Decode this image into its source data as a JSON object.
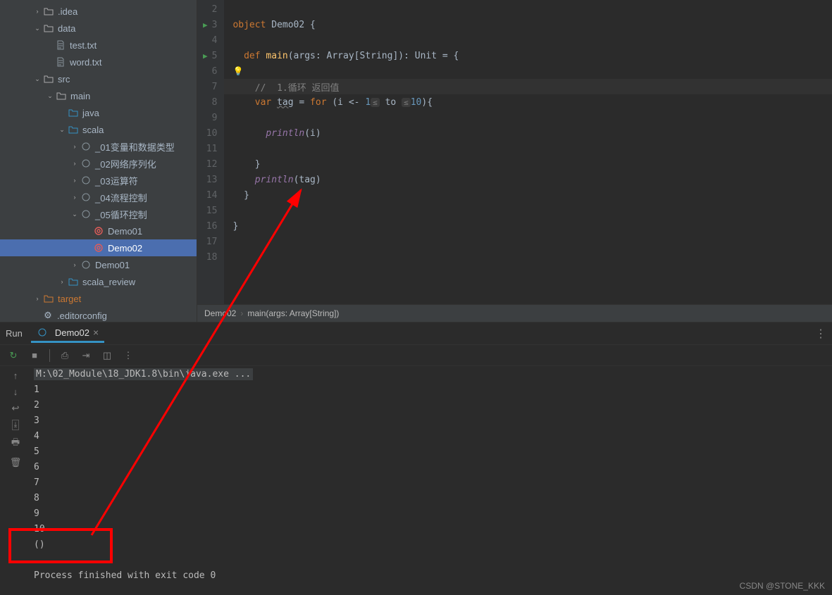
{
  "tree": {
    "idea": ".idea",
    "data": "data",
    "test_txt": "test.txt",
    "word_txt": "word.txt",
    "src": "src",
    "main": "main",
    "java": "java",
    "scala": "scala",
    "p01": "_01变量和数据类型",
    "p02": "_02网络序列化",
    "p03": "_03运算符",
    "p04": "_04流程控制",
    "p05": "_05循环控制",
    "demo01": "Demo01",
    "demo02": "Demo02",
    "demo01b": "Demo01",
    "scala_review": "scala_review",
    "target": "target",
    "editorconfig": ".editorconfig"
  },
  "code": {
    "l3": {
      "a": "object ",
      "b": "Demo02 {"
    },
    "l5": {
      "a": "  def ",
      "b": "main",
      "c": "(args: Array[String]): Unit = {"
    },
    "l7": "    //  1.循环 返回值",
    "l8": {
      "a": "    var ",
      "b": "tag",
      "c": " = ",
      "d": "for ",
      "e": "(i <- ",
      "f": "1",
      "g": " to ",
      "h": "10",
      "i": "){"
    },
    "l10": {
      "a": "      ",
      "b": "println",
      "c": "(i)"
    },
    "l12": "    }",
    "l13": {
      "a": "    ",
      "b": "println",
      "c": "(tag)"
    },
    "l14": "  }",
    "l16": "}",
    "hint_lte": "≤"
  },
  "crumbs": {
    "a": "Demo02",
    "b": "main(args: Array[String])"
  },
  "run": {
    "tab_run": "Run",
    "tab_name": "Demo02",
    "cmd": "M:\\02_Module\\18_JDK1.8\\bin\\java.exe ...",
    "out": [
      "1",
      "2",
      "3",
      "4",
      "5",
      "6",
      "7",
      "8",
      "9",
      "10",
      "()"
    ],
    "finish": "Process finished with exit code 0"
  },
  "watermark": "CSDN @STONE_KKK"
}
